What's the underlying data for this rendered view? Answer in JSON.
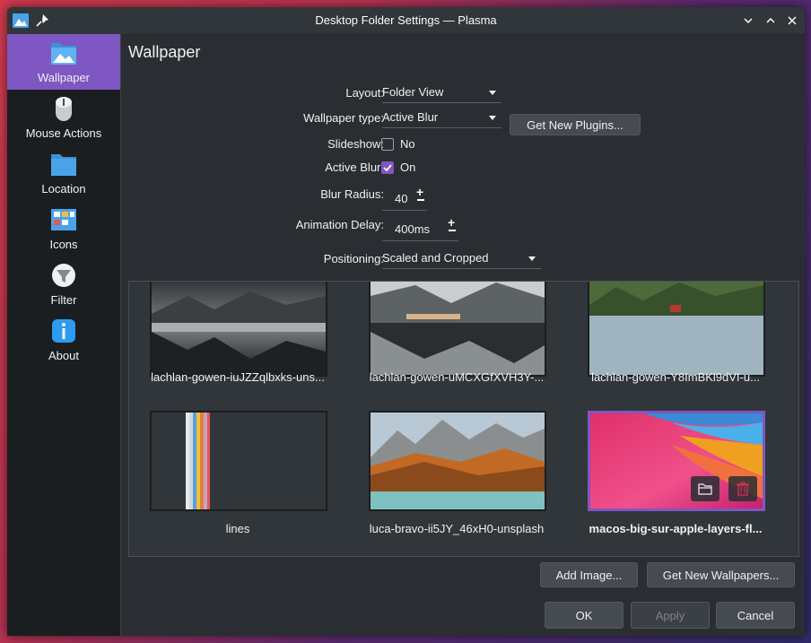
{
  "window": {
    "title": "Desktop Folder Settings — Plasma"
  },
  "sidebar": {
    "items": [
      {
        "label": "Wallpaper",
        "icon": "wallpaper-folder-icon"
      },
      {
        "label": "Mouse Actions",
        "icon": "mouse-icon"
      },
      {
        "label": "Location",
        "icon": "folder-icon"
      },
      {
        "label": "Icons",
        "icon": "icons-icon"
      },
      {
        "label": "Filter",
        "icon": "filter-icon"
      },
      {
        "label": "About",
        "icon": "info-icon"
      }
    ]
  },
  "page": {
    "title": "Wallpaper"
  },
  "form": {
    "layout_label": "Layout:",
    "layout_value": "Folder View",
    "wallpaper_type_label": "Wallpaper type:",
    "wallpaper_type_value": "Active Blur",
    "get_plugins_label": "Get New Plugins...",
    "slideshow_label": "Slideshow:",
    "slideshow_value": "No",
    "active_blur_label": "Active Blur:",
    "active_blur_value": "On",
    "blur_radius_label": "Blur Radius:",
    "blur_radius_value": "40",
    "animation_delay_label": "Animation Delay:",
    "animation_delay_value": "400ms",
    "positioning_label": "Positioning:",
    "positioning_value": "Scaled and Cropped"
  },
  "wallpapers": [
    {
      "name": "lachlan-gowen-iuJZZqlbxks-uns..."
    },
    {
      "name": "lachlan-gowen-uMCXGfXVH3Y-..."
    },
    {
      "name": "lachlan-gowen-Y8ImBKl9dVI-u..."
    },
    {
      "name": "lines"
    },
    {
      "name": "luca-bravo-ii5JY_46xH0-unsplash"
    },
    {
      "name": "macos-big-sur-apple-layers-fl..."
    }
  ],
  "actions": {
    "add_image": "Add Image...",
    "get_wallpapers": "Get New Wallpapers...",
    "ok": "OK",
    "apply": "Apply",
    "cancel": "Cancel"
  },
  "colors": {
    "accent": "#7e57c2",
    "window_bg": "#2a2e32",
    "sidebar_bg": "#1b1e20"
  }
}
